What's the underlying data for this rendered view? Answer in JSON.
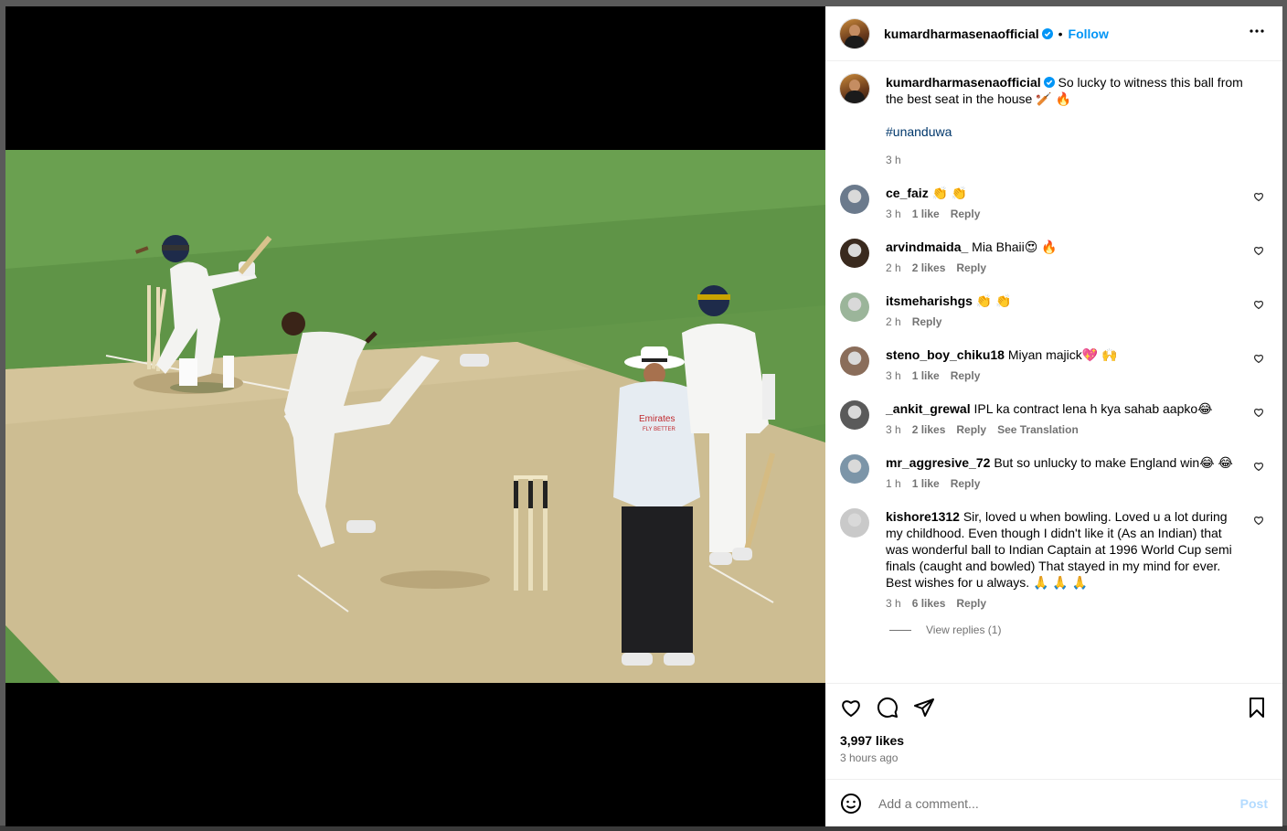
{
  "post": {
    "author": "kumardharmasenaofficial",
    "follow_label": "Follow",
    "dot": "•",
    "caption_text": "So lucky to witness this ball from the best seat in the house 🏏 🔥",
    "hashtag": "#unanduwa",
    "caption_time": "3 h",
    "likes": "3,997 likes",
    "time_ago": "3 hours ago"
  },
  "comments": [
    {
      "user": "ce_faiz",
      "text": "👏 👏",
      "time": "3 h",
      "likes": "1 like",
      "reply": "Reply",
      "avatar_color": "#6b7a8c"
    },
    {
      "user": "arvindmaida_",
      "text": "Mia Bhaii😍 🔥",
      "time": "2 h",
      "likes": "2 likes",
      "reply": "Reply",
      "avatar_color": "#3a2a1e"
    },
    {
      "user": "itsmeharishgs",
      "text": "👏 👏",
      "time": "2 h",
      "likes": "",
      "reply": "Reply",
      "avatar_color": "#9bb59a"
    },
    {
      "user": "steno_boy_chiku18",
      "text": "Miyan majick💖 🙌",
      "time": "3 h",
      "likes": "1 like",
      "reply": "Reply",
      "avatar_color": "#8a6d5a"
    },
    {
      "user": "_ankit_grewal",
      "text": "IPL ka contract lena h kya sahab aapko😂",
      "time": "3 h",
      "likes": "2 likes",
      "reply": "Reply",
      "translation": "See Translation",
      "avatar_color": "#5a5a5a"
    },
    {
      "user": "mr_aggresive_72",
      "text": "But so unlucky to make England win😂 😂",
      "time": "1 h",
      "likes": "1 like",
      "reply": "Reply",
      "avatar_color": "#7c95a8"
    },
    {
      "user": "kishore1312",
      "text": "Sir, loved u when bowling. Loved u a lot during my childhood. Even though I didn't like it (As an Indian) that was wonderful ball to Indian Captain at 1996 World Cup semi finals (caught and bowled) That stayed in my mind for ever. Best wishes for u always. 🙏 🙏 🙏",
      "time": "3 h",
      "likes": "6 likes",
      "reply": "Reply",
      "avatar_color": "#c9c9c9"
    }
  ],
  "view_replies": "View replies (1)",
  "add_comment": {
    "placeholder": "Add a comment...",
    "post_label": "Post"
  },
  "photo": {
    "umpire_sponsor": "Emirates",
    "umpire_sponsor_sub": "FLY BETTER"
  }
}
